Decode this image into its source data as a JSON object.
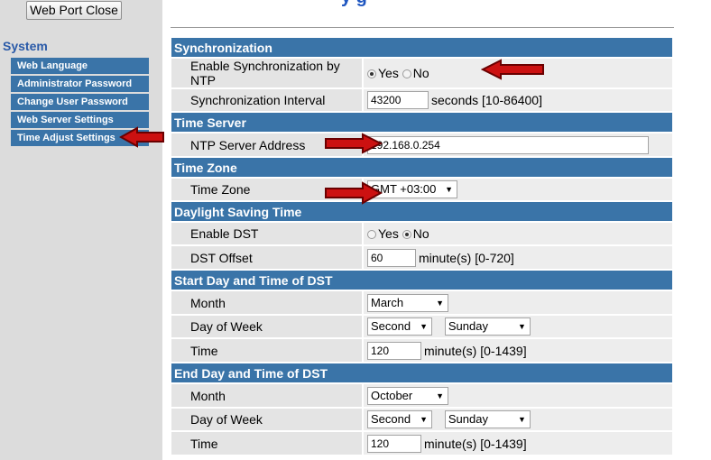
{
  "header": {
    "close_label": "Web Port Close",
    "title_fragment": "y    g"
  },
  "sidebar": {
    "title": "System",
    "items": [
      {
        "label": "Web Language"
      },
      {
        "label": "Administrator Password"
      },
      {
        "label": "Change User Password"
      },
      {
        "label": "Web Server Settings"
      },
      {
        "label": "Time Adjust Settings"
      }
    ]
  },
  "sync": {
    "section": "Synchronization",
    "enable_label": "Enable Synchronization by NTP",
    "yes": "Yes",
    "no": "No",
    "enabled": "yes",
    "interval_label": "Synchronization Interval",
    "interval_value": "43200",
    "interval_unit": "seconds [10-86400]"
  },
  "time_server": {
    "section": "Time Server",
    "ntp_label": "NTP Server Address",
    "ntp_value": "192.168.0.254"
  },
  "time_zone": {
    "section": "Time Zone",
    "label": "Time Zone",
    "value": "GMT +03:00"
  },
  "dst": {
    "section": "Daylight Saving Time",
    "enable_label": "Enable DST",
    "yes": "Yes",
    "no": "No",
    "enabled": "no",
    "offset_label": "DST Offset",
    "offset_value": "60",
    "offset_unit": "minute(s) [0-720]"
  },
  "dst_start": {
    "section": "Start Day and Time of DST",
    "month_label": "Month",
    "month_value": "March",
    "dow_label": "Day of Week",
    "week_value": "Second",
    "day_value": "Sunday",
    "time_label": "Time",
    "time_value": "120",
    "time_unit": "minute(s) [0-1439]"
  },
  "dst_end": {
    "section": "End Day and Time of DST",
    "month_label": "Month",
    "month_value": "October",
    "dow_label": "Day of Week",
    "week_value": "Second",
    "day_value": "Sunday",
    "time_label": "Time",
    "time_value": "120",
    "time_unit": "minute(s) [0-1439]"
  },
  "colors": {
    "section_bg": "#3a74a8",
    "sidebar_bg": "#dcdcdc",
    "arrow": "#cc0000"
  },
  "icons": [
    "arrow-icon",
    "caret-down-icon",
    "radio-icon"
  ]
}
